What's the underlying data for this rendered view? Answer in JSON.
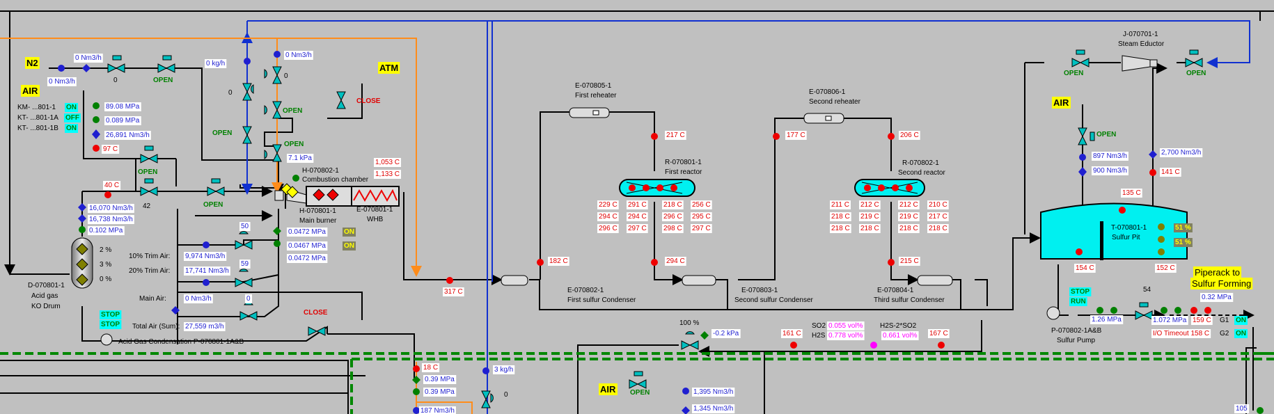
{
  "colors": {
    "background": "#c0c0c0",
    "blue_value": "#1f1fd0",
    "red_value": "#e00000",
    "green_value": "#008000",
    "cyan_tag": "#00ffff",
    "yellow_tag": "#ffff00",
    "equipment_cyan": "#00f0f0",
    "gas_line": "#ff8c1a",
    "flow_line": "#1030d0",
    "dash_line": "#008800"
  },
  "icons": [
    "valve-icon",
    "control-valve-icon",
    "pump-icon",
    "heat-exchanger-icon",
    "vessel-icon",
    "eductor-icon"
  ],
  "texts": [
    {
      "id": "n2",
      "t": "N2"
    },
    {
      "id": "air1",
      "t": "AIR"
    },
    {
      "id": "atm",
      "t": "ATM"
    },
    {
      "id": "n2flow1",
      "t": "0 Nm3/h"
    },
    {
      "id": "n2flow2",
      "t": "0 Nm3/h"
    },
    {
      "id": "v0a",
      "t": "0"
    },
    {
      "id": "open1",
      "t": "OPEN"
    },
    {
      "id": "kgh0",
      "t": "0 kg/h"
    },
    {
      "id": "nm0",
      "t": "0 Nm3/h"
    },
    {
      "id": "v0b",
      "t": "0"
    },
    {
      "id": "v0c",
      "t": "0"
    },
    {
      "id": "open2",
      "t": "OPEN"
    },
    {
      "id": "open3",
      "t": "OPEN"
    },
    {
      "id": "open4",
      "t": "OPEN"
    },
    {
      "id": "close1",
      "t": "CLOSE"
    },
    {
      "id": "km",
      "t": "KM- ...801-1"
    },
    {
      "id": "kt1",
      "t": "KT- ...801-1A"
    },
    {
      "id": "kt2",
      "t": "KT- ...801-1B"
    },
    {
      "id": "on1",
      "t": "ON"
    },
    {
      "id": "off1",
      "t": "OFF"
    },
    {
      "id": "on2",
      "t": "ON"
    },
    {
      "id": "mpa1",
      "t": "89.08 MPa"
    },
    {
      "id": "mpa2",
      "t": "0.089 MPa"
    },
    {
      "id": "airflow",
      "t": "26,891 Nm3/h"
    },
    {
      "id": "t97",
      "t": "97 C"
    },
    {
      "id": "kpa71",
      "t": "7.1 kPa"
    },
    {
      "id": "open5",
      "t": "OPEN"
    },
    {
      "id": "t40",
      "t": "40 C"
    },
    {
      "id": "v42",
      "t": "42"
    },
    {
      "id": "open6",
      "t": "OPEN"
    },
    {
      "id": "hdr1",
      "t": "H-070802-1"
    },
    {
      "id": "hdr1n",
      "t": "Combustion chamber"
    },
    {
      "id": "t1053",
      "t": "1,053 C"
    },
    {
      "id": "t1133",
      "t": "1,133 C"
    },
    {
      "id": "hmb",
      "t": "H-070801-1"
    },
    {
      "id": "hmbn",
      "t": "Main burner"
    },
    {
      "id": "whb",
      "t": "E-070801-1"
    },
    {
      "id": "whbn",
      "t": "WHB"
    },
    {
      "id": "ag1",
      "t": "16,070 Nm3/h"
    },
    {
      "id": "ag2",
      "t": "16,738 Nm3/h"
    },
    {
      "id": "agp",
      "t": "0.102 MPa"
    },
    {
      "id": "p2",
      "t": "2 %"
    },
    {
      "id": "p3",
      "t": "3 %"
    },
    {
      "id": "p0",
      "t": "0 %"
    },
    {
      "id": "drum",
      "t": "D-070801-1"
    },
    {
      "id": "drum2",
      "t": "Acid gas"
    },
    {
      "id": "drum3",
      "t": "KO Drum"
    },
    {
      "id": "v50",
      "t": "50"
    },
    {
      "id": "v59",
      "t": "59"
    },
    {
      "id": "v0d",
      "t": "0"
    },
    {
      "id": "trim10",
      "t": "10% Trim Air:"
    },
    {
      "id": "trim10v",
      "t": "9,974 Nm3/h"
    },
    {
      "id": "trim20",
      "t": "20% Trim Air:"
    },
    {
      "id": "trim20v",
      "t": "17,741 Nm3/h"
    },
    {
      "id": "mainair",
      "t": "Main Air:"
    },
    {
      "id": "mainairv",
      "t": "0 Nm3/h"
    },
    {
      "id": "totair",
      "t": "Total Air (Sum):"
    },
    {
      "id": "totairv",
      "t": "27,559 m3/h"
    },
    {
      "id": "bp1",
      "t": "0.0472 MPa"
    },
    {
      "id": "bp2",
      "t": "0.0467 MPa"
    },
    {
      "id": "bp3",
      "t": "0.0472 MPa"
    },
    {
      "id": "on3",
      "t": "ON"
    },
    {
      "id": "on4",
      "t": "ON"
    },
    {
      "id": "stop1",
      "t": "STOP"
    },
    {
      "id": "stop2",
      "t": "STOP"
    },
    {
      "id": "close2",
      "t": "CLOSE"
    },
    {
      "id": "agpump",
      "t": "Acid Gas Condensation  P-070801-1A&B"
    },
    {
      "id": "t317",
      "t": "317 C"
    },
    {
      "id": "t182",
      "t": "182 C"
    },
    {
      "id": "c1",
      "t": "E-070802-1"
    },
    {
      "id": "c1n",
      "t": "First sulfur Condenser"
    },
    {
      "id": "rh1",
      "t": "E-070805-1"
    },
    {
      "id": "rh1n",
      "t": "First reheater"
    },
    {
      "id": "t217",
      "t": "217 C"
    },
    {
      "id": "r1",
      "t": "R-070801-1"
    },
    {
      "id": "r1n",
      "t": "First reactor"
    },
    {
      "id": "r1a",
      "t": "229 C"
    },
    {
      "id": "r1b",
      "t": "294 C"
    },
    {
      "id": "r1c",
      "t": "296 C"
    },
    {
      "id": "r1d",
      "t": "291 C"
    },
    {
      "id": "r1e",
      "t": "294 C"
    },
    {
      "id": "r1f",
      "t": "297 C"
    },
    {
      "id": "r1g",
      "t": "218 C"
    },
    {
      "id": "r1h",
      "t": "296 C"
    },
    {
      "id": "r1i",
      "t": "298 C"
    },
    {
      "id": "r1j",
      "t": "256 C"
    },
    {
      "id": "r1k",
      "t": "295 C"
    },
    {
      "id": "r1l",
      "t": "297 C"
    },
    {
      "id": "t294",
      "t": "294 C"
    },
    {
      "id": "c2",
      "t": "E-070803-1"
    },
    {
      "id": "c2n",
      "t": "Second sulfur Condenser"
    },
    {
      "id": "t177",
      "t": "177 C"
    },
    {
      "id": "rh2",
      "t": "E-070806-1"
    },
    {
      "id": "rh2n",
      "t": "Second reheater"
    },
    {
      "id": "t206",
      "t": "206 C"
    },
    {
      "id": "r2",
      "t": "R-070802-1"
    },
    {
      "id": "r2n",
      "t": "Second reactor"
    },
    {
      "id": "r2a",
      "t": "211 C"
    },
    {
      "id": "r2b",
      "t": "218 C"
    },
    {
      "id": "r2c",
      "t": "218 C"
    },
    {
      "id": "r2d",
      "t": "212 C"
    },
    {
      "id": "r2e",
      "t": "219 C"
    },
    {
      "id": "r2f",
      "t": "218 C"
    },
    {
      "id": "r2g",
      "t": "212 C"
    },
    {
      "id": "r2h",
      "t": "219 C"
    },
    {
      "id": "r2i",
      "t": "218 C"
    },
    {
      "id": "r2j",
      "t": "210 C"
    },
    {
      "id": "r2k",
      "t": "217 C"
    },
    {
      "id": "r2l",
      "t": "218 C"
    },
    {
      "id": "t215",
      "t": "215 C"
    },
    {
      "id": "c3",
      "t": "E-070804-1"
    },
    {
      "id": "c3n",
      "t": "Third sulfur Condenser"
    },
    {
      "id": "so2",
      "t": "SO2"
    },
    {
      "id": "so2v",
      "t": "0.055 vol%"
    },
    {
      "id": "h2s",
      "t": "H2S"
    },
    {
      "id": "h2sv",
      "t": "0.778 vol%"
    },
    {
      "id": "ratio",
      "t": "H2S-2*SO2"
    },
    {
      "id": "ratiov",
      "t": "0.661 vol%"
    },
    {
      "id": "t161",
      "t": "161 C"
    },
    {
      "id": "t167",
      "t": "167 C"
    },
    {
      "id": "p100",
      "t": "100 %"
    },
    {
      "id": "kpa02",
      "t": "-0.2 kPa"
    },
    {
      "id": "ej",
      "t": "J-070701-1"
    },
    {
      "id": "ejn",
      "t": "Steam Eductor"
    },
    {
      "id": "open7",
      "t": "OPEN"
    },
    {
      "id": "open8",
      "t": "OPEN"
    },
    {
      "id": "air2",
      "t": "AIR"
    },
    {
      "id": "open9",
      "t": "OPEN"
    },
    {
      "id": "pf1",
      "t": "897 Nm3/h"
    },
    {
      "id": "pf2",
      "t": "900 Nm3/h"
    },
    {
      "id": "pf3",
      "t": "2,700 Nm3/h"
    },
    {
      "id": "t141",
      "t": "141 C"
    },
    {
      "id": "t135",
      "t": "135 C"
    },
    {
      "id": "pit",
      "t": "T-070801-1"
    },
    {
      "id": "pitn",
      "t": "Sulfur  Pit"
    },
    {
      "id": "l51a",
      "t": "51 %"
    },
    {
      "id": "l51b",
      "t": "51 %"
    },
    {
      "id": "t154",
      "t": "154 C"
    },
    {
      "id": "t152",
      "t": "152 C"
    },
    {
      "id": "pipe1",
      "t": "Piperack to"
    },
    {
      "id": "pipe2",
      "t": "Sulfur Forming"
    },
    {
      "id": "stop3",
      "t": "STOP"
    },
    {
      "id": "run",
      "t": "RUN"
    },
    {
      "id": "v54",
      "t": "54"
    },
    {
      "id": "mpa032",
      "t": "0.32 MPa"
    },
    {
      "id": "mpa126",
      "t": "1.26 MPa"
    },
    {
      "id": "mpa1072",
      "t": "1.072 MPa"
    },
    {
      "id": "t159",
      "t": "159 C"
    },
    {
      "id": "timeout",
      "t": "I/O Timeout 158 C"
    },
    {
      "id": "g1",
      "t": "G1"
    },
    {
      "id": "g2",
      "t": "G2"
    },
    {
      "id": "on5",
      "t": "ON"
    },
    {
      "id": "on6",
      "t": "ON"
    },
    {
      "id": "spump",
      "t": "P-070802-1A&B"
    },
    {
      "id": "spumpn",
      "t": "Sulfur Pump"
    },
    {
      "id": "t18",
      "t": "18 C"
    },
    {
      "id": "mpa039a",
      "t": "0.39 MPa"
    },
    {
      "id": "mpa039b",
      "t": "0.39 MPa"
    },
    {
      "id": "flow187",
      "t": "187 Nm3/h"
    },
    {
      "id": "kgh3",
      "t": "3 kg/h"
    },
    {
      "id": "v0e",
      "t": "0"
    },
    {
      "id": "air3",
      "t": "AIR"
    },
    {
      "id": "open10",
      "t": "OPEN"
    },
    {
      "id": "f1395",
      "t": "1,395 Nm3/h"
    },
    {
      "id": "f1345",
      "t": "1,345 Nm3/h"
    },
    {
      "id": "v105",
      "t": "105"
    }
  ]
}
